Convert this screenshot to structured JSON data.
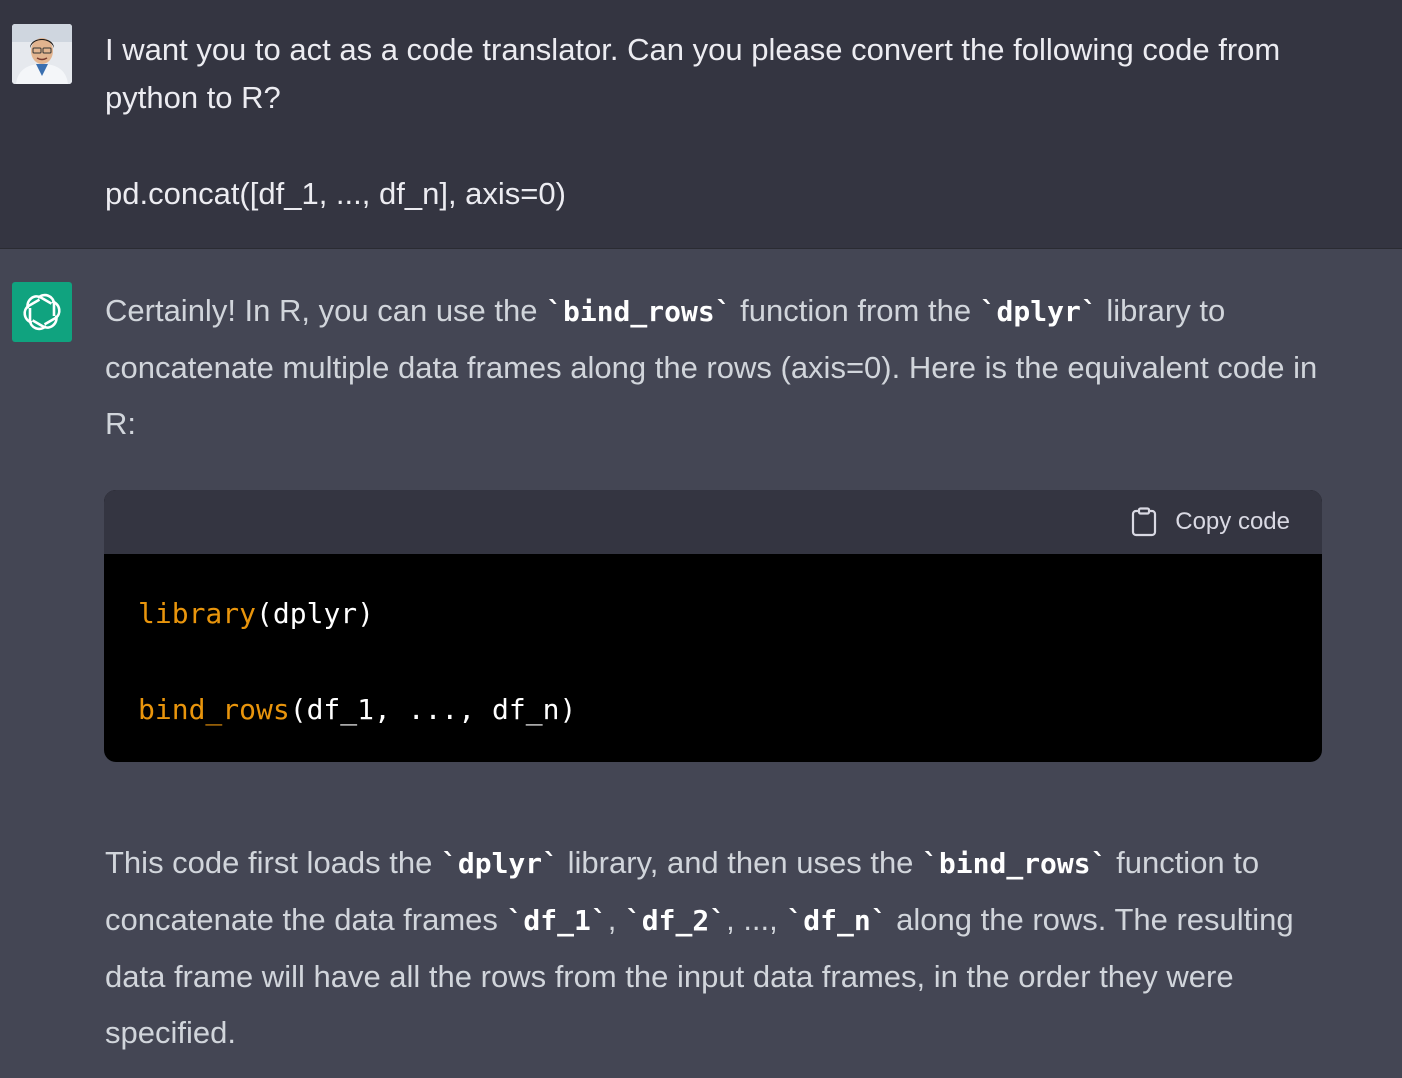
{
  "user": {
    "line1": "I want you to act as a code translator. Can you please convert the following code from python to R?",
    "code": "pd.concat([df_1, ..., df_n], axis=0)"
  },
  "assistant": {
    "p1": [
      "Certainly! In R, you can use the ",
      "`bind_rows`",
      " function from the ",
      "`dplyr`",
      " library to concatenate multiple data frames along the rows (axis=0). Here is the equivalent code in R:"
    ],
    "code_block": {
      "copy_label": "Copy code",
      "line1_fn": "library",
      "line1_rest": "(dplyr)",
      "line3_fn": "bind_rows",
      "line3_rest": "(df_1, ..., df_n)"
    },
    "p2": [
      "This code first loads the ",
      "`dplyr`",
      " library, and then uses the ",
      "`bind_rows`",
      " function to concatenate the data frames ",
      "`df_1`",
      ", ",
      "`df_2`",
      ", ..., ",
      "`df_n`",
      " along the rows. The resulting data frame will have all the rows from the input data frames, in the order they were specified."
    ]
  },
  "icons": {
    "user_avatar": "user-avatar",
    "assistant_avatar": "openai-logo-icon",
    "copy": "clipboard-icon"
  },
  "colors": {
    "user_bg": "#343541",
    "assistant_bg": "#444654",
    "assistant_avatar_bg": "#10a37f",
    "code_fn": "#e9950c"
  }
}
